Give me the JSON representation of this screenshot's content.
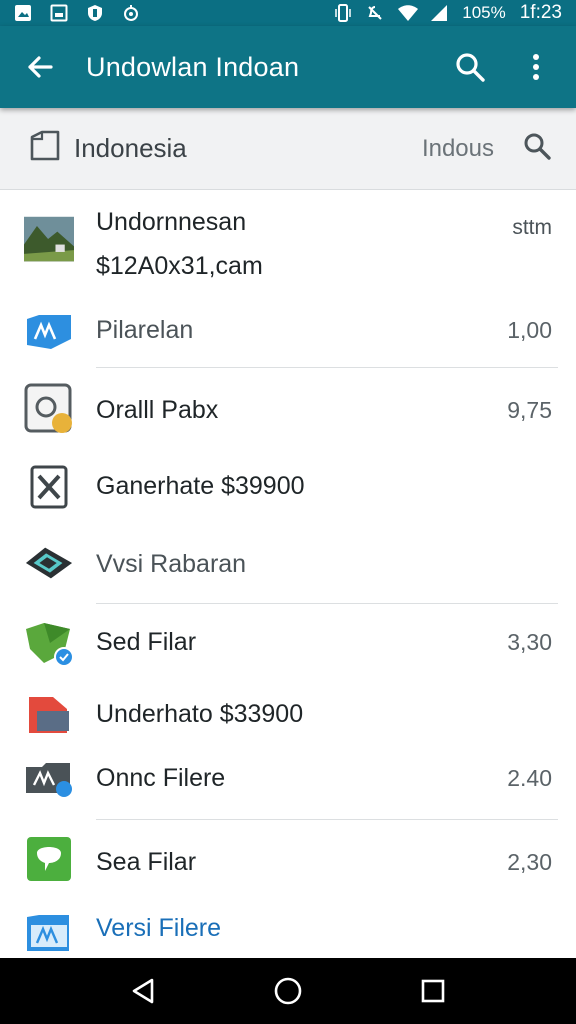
{
  "status_bar": {
    "battery": "105%",
    "time": "1f:23"
  },
  "app_bar": {
    "title": "Undowlan Indoan"
  },
  "sub_header": {
    "title": "Indonesia",
    "filter": "Indous"
  },
  "list": {
    "items": [
      {
        "label": "Undornnesan",
        "sub": "$12A0x31,cam",
        "value": "sttm",
        "icon": "landscape-photo-icon"
      },
      {
        "label": "Pilarelan",
        "value": "1,00",
        "icon": "blue-folder-icon"
      },
      {
        "label": "Oralll Pabx",
        "value": "9,75",
        "icon": "camera-icon"
      },
      {
        "label": "Ganerhate $39900",
        "value": "",
        "icon": "archive-icon"
      },
      {
        "label": "Vvsi Rabaran",
        "value": "",
        "icon": "layers-icon"
      },
      {
        "label": "Sed Filar",
        "value": "3,30",
        "icon": "green-folder-icon"
      },
      {
        "label": "Underhato $33900",
        "value": "",
        "icon": "red-file-icon"
      },
      {
        "label": "Onnc Filere",
        "value": "2.40",
        "icon": "dark-folder-icon"
      },
      {
        "label": "Sea Filar",
        "value": "2,30",
        "icon": "green-chat-icon"
      },
      {
        "label": "Versi Filere",
        "value": "",
        "icon": "blue-file-icon"
      }
    ]
  },
  "colors": {
    "app_bar": "#0e7486",
    "status_bar": "#0b6f83",
    "link": "#1a6fb8"
  }
}
